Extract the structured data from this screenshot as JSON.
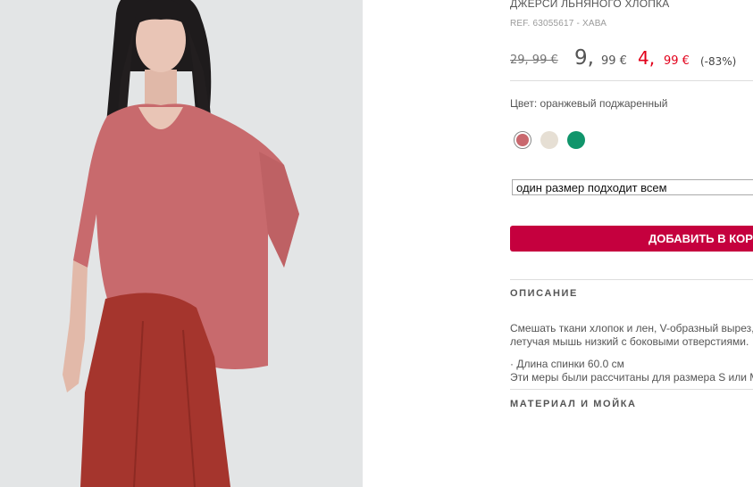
{
  "product": {
    "title": "ДЖЕРСИ ЛЬНЯНОГО ХЛОПКА",
    "ref": "REF. 63055617 - ХАВА",
    "image_alt": "Модель в розовом трикотажном джемпере и красных брюках"
  },
  "price": {
    "original": "29, 99 €",
    "previous_main": "9,",
    "previous_cents": "99 €",
    "sale_main": "4,",
    "sale_cents": "99 €",
    "discount": "(-83%)"
  },
  "color": {
    "label": "Цвет: оранжевый поджаренный",
    "swatches": [
      {
        "name": "coral-swatch",
        "hex": "#c9686e",
        "selected": true
      },
      {
        "name": "beige-swatch",
        "hex": "#e6dfd4",
        "selected": false
      },
      {
        "name": "green-swatch",
        "hex": "#10956b",
        "selected": false
      }
    ]
  },
  "size": {
    "selected": "один размер подходит всем",
    "arrow": "▼"
  },
  "cart": {
    "button_label": "ДОБАВИТЬ В КОРЗИНУ"
  },
  "description": {
    "heading": "ОПИСАНИЕ",
    "line1": "Смешать ткани хлопок и лен, V-образный вырез,",
    "line2": "летучая мышь низкий с боковыми отверстиями.",
    "line3": "· Длина спинки 60.0 см",
    "line4": "Эти меры были рассчитаны для размера S или M."
  },
  "care": {
    "heading": "МАТЕРИАЛ И МОЙКА"
  },
  "colors": {
    "accent": "#c5003e",
    "sale_red": "#e2001a"
  }
}
